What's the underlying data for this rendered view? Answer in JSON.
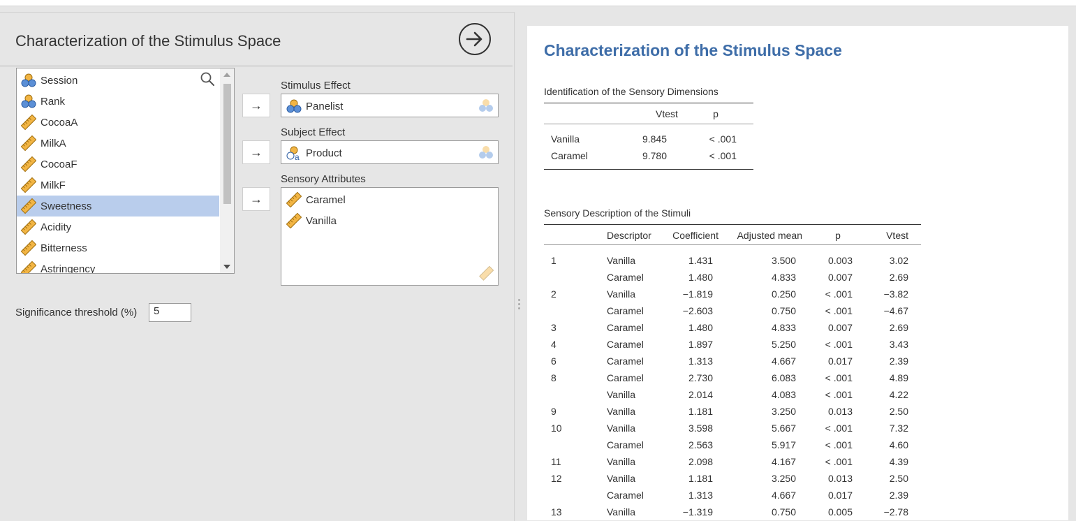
{
  "analysis_title": "Characterization of the Stimulus Space",
  "variables": [
    {
      "name": "Session",
      "type": "nominal-icon"
    },
    {
      "name": "Rank",
      "type": "nominal-icon"
    },
    {
      "name": "CocoaA",
      "type": "ruler-icon"
    },
    {
      "name": "MilkA",
      "type": "ruler-icon"
    },
    {
      "name": "CocoaF",
      "type": "ruler-icon"
    },
    {
      "name": "MilkF",
      "type": "ruler-icon"
    },
    {
      "name": "Sweetness",
      "type": "ruler-icon",
      "selected": true
    },
    {
      "name": "Acidity",
      "type": "ruler-icon"
    },
    {
      "name": "Bitterness",
      "type": "ruler-icon"
    },
    {
      "name": "Astringency",
      "type": "ruler-icon"
    }
  ],
  "move_arrow": "→",
  "stimulus_effect": {
    "label": "Stimulus Effect",
    "value": "Panelist"
  },
  "subject_effect": {
    "label": "Subject Effect",
    "value": "Product"
  },
  "sensory_attributes": {
    "label": "Sensory Attributes",
    "items": [
      "Caramel",
      "Vanilla"
    ]
  },
  "significance": {
    "label": "Significance threshold (%)",
    "value": "5"
  },
  "results": {
    "title": "Characterization of the Stimulus Space",
    "table1": {
      "caption": "Identification of the Sensory Dimensions",
      "headers": [
        "",
        "Vtest",
        "p"
      ],
      "rows": [
        [
          "Vanilla",
          "9.845",
          "< .001"
        ],
        [
          "Caramel",
          "9.780",
          "< .001"
        ]
      ]
    },
    "table2": {
      "caption": "Sensory Description of the Stimuli",
      "headers": [
        "",
        "Descriptor",
        "Coefficient",
        "Adjusted mean",
        "p",
        "Vtest"
      ],
      "rows": [
        [
          "1",
          "Vanilla",
          "1.431",
          "3.500",
          "0.003",
          "3.02"
        ],
        [
          "",
          "Caramel",
          "1.480",
          "4.833",
          "0.007",
          "2.69"
        ],
        [
          "2",
          "Vanilla",
          "−1.819",
          "0.250",
          "< .001",
          "−3.82"
        ],
        [
          "",
          "Caramel",
          "−2.603",
          "0.750",
          "< .001",
          "−4.67"
        ],
        [
          "3",
          "Caramel",
          "1.480",
          "4.833",
          "0.007",
          "2.69"
        ],
        [
          "4",
          "Caramel",
          "1.897",
          "5.250",
          "< .001",
          "3.43"
        ],
        [
          "6",
          "Caramel",
          "1.313",
          "4.667",
          "0.017",
          "2.39"
        ],
        [
          "8",
          "Caramel",
          "2.730",
          "6.083",
          "< .001",
          "4.89"
        ],
        [
          "",
          "Vanilla",
          "2.014",
          "4.083",
          "< .001",
          "4.22"
        ],
        [
          "9",
          "Vanilla",
          "1.181",
          "3.250",
          "0.013",
          "2.50"
        ],
        [
          "10",
          "Vanilla",
          "3.598",
          "5.667",
          "< .001",
          "7.32"
        ],
        [
          "",
          "Caramel",
          "2.563",
          "5.917",
          "< .001",
          "4.60"
        ],
        [
          "11",
          "Vanilla",
          "2.098",
          "4.167",
          "< .001",
          "4.39"
        ],
        [
          "12",
          "Vanilla",
          "1.181",
          "3.250",
          "0.013",
          "2.50"
        ],
        [
          "",
          "Caramel",
          "1.313",
          "4.667",
          "0.017",
          "2.39"
        ],
        [
          "13",
          "Vanilla",
          "−1.319",
          "0.750",
          "0.005",
          "−2.78"
        ]
      ]
    }
  }
}
